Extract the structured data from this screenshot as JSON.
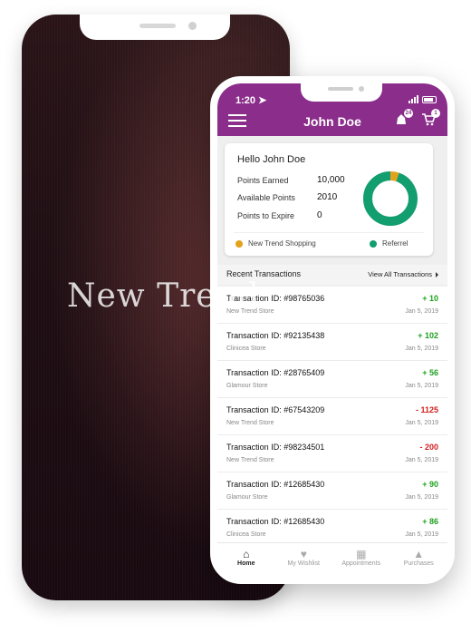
{
  "background": {
    "brand_text": "New Trend"
  },
  "status_bar": {
    "time": "1:20"
  },
  "header": {
    "title": "John Doe",
    "wallet_badge": "24",
    "cart_badge": "1"
  },
  "summary": {
    "greeting": "Hello John Doe",
    "rows": [
      {
        "label": "Points Earned",
        "value": "10,000"
      },
      {
        "label": "Available Points",
        "value": "2010"
      },
      {
        "label": "Points to Expire",
        "value": "0"
      }
    ],
    "donut": {
      "segments": [
        {
          "name": "New Trend Shopping",
          "fraction": 0.05,
          "color": "#e3a21a"
        },
        {
          "name": "Referrel",
          "fraction": 0.95,
          "color": "#129e6e"
        }
      ]
    },
    "legend": [
      {
        "label": "New Trend Shopping",
        "color": "#e3a21a"
      },
      {
        "label": "Referrel",
        "color": "#129e6e"
      }
    ]
  },
  "recent": {
    "title": "Recent Transactions",
    "view_all": "View All Transactions",
    "items": [
      {
        "id": "Transaction ID: #98765036",
        "store": "New Trend Store",
        "amount": "+ 10",
        "date": "Jan 5, 2019",
        "kind": "pos"
      },
      {
        "id": "Transaction ID: #92135438",
        "store": "Clinicea Store",
        "amount": "+ 102",
        "date": "Jan 5, 2019",
        "kind": "pos"
      },
      {
        "id": "Transaction ID: #28765409",
        "store": "Glamour Store",
        "amount": "+ 56",
        "date": "Jan 5, 2019",
        "kind": "pos"
      },
      {
        "id": "Transaction ID: #67543209",
        "store": "New Trend Store",
        "amount": "- 1125",
        "date": "Jan 5, 2019",
        "kind": "neg"
      },
      {
        "id": "Transaction ID: #98234501",
        "store": "New Trend Store",
        "amount": "- 200",
        "date": "Jan 5, 2019",
        "kind": "neg"
      },
      {
        "id": "Transaction ID: #12685430",
        "store": "Glamour Store",
        "amount": "+ 90",
        "date": "Jan 5, 2019",
        "kind": "pos"
      },
      {
        "id": "Transaction ID: #12685430",
        "store": "Clinicea Store",
        "amount": "+ 86",
        "date": "Jan 5, 2019",
        "kind": "pos"
      }
    ]
  },
  "nav": [
    {
      "label": "Home",
      "icon": "home-icon",
      "active": true
    },
    {
      "label": "My Wishlist",
      "icon": "heart-icon",
      "active": false
    },
    {
      "label": "Appointments",
      "icon": "calendar-icon",
      "active": false
    },
    {
      "label": "Purchases",
      "icon": "bag-icon",
      "active": false
    }
  ]
}
